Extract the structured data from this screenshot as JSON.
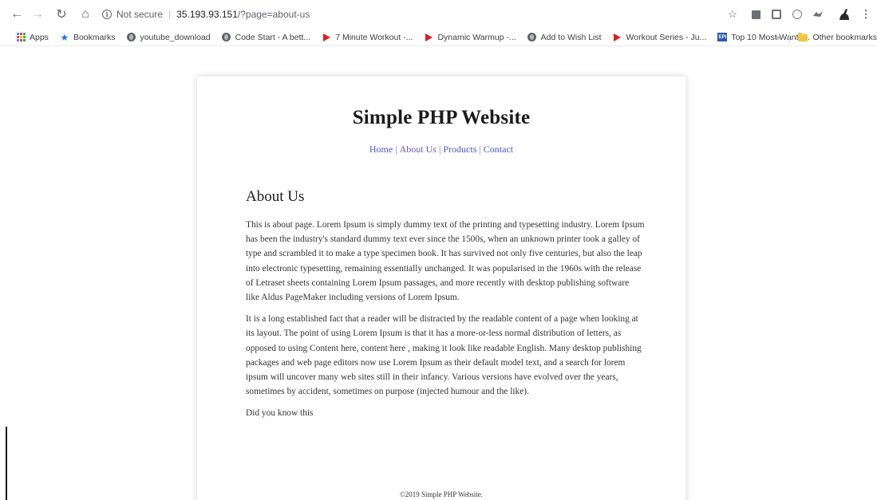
{
  "browser": {
    "url_security": "Not secure",
    "url_host": "35.193.93.151",
    "url_path": "/?page=about-us",
    "bookmarks": [
      {
        "label": "Apps",
        "icon": "apps-grid-icon"
      },
      {
        "label": "Bookmarks",
        "icon": "star-icon"
      },
      {
        "label": "youtube_download",
        "icon": "globe-icon"
      },
      {
        "label": "Code Start - A bett...",
        "icon": "globe-icon"
      },
      {
        "label": "7 Minute Workout -...",
        "icon": "youtube-icon"
      },
      {
        "label": "Dynamic Warmup -...",
        "icon": "youtube-icon"
      },
      {
        "label": "Add to Wish List",
        "icon": "globe-icon"
      },
      {
        "label": "Workout Series - Ju...",
        "icon": "youtube-icon"
      },
      {
        "label": "Top 10 Most Wante...",
        "icon": "epi-icon"
      }
    ],
    "other_bookmarks": "Other bookmarks",
    "overflow_chevron": "»"
  },
  "site": {
    "title": "Simple PHP Website",
    "nav": [
      {
        "label": "Home"
      },
      {
        "label": "About Us"
      },
      {
        "label": "Products"
      },
      {
        "label": "Contact"
      }
    ],
    "nav_separator": "|",
    "page_heading": "About Us",
    "paragraphs": [
      "This is about page. Lorem Ipsum is simply dummy text of the printing and typesetting industry. Lorem Ipsum has been the industry's standard dummy text ever since the 1500s, when an unknown printer took a galley of type and scrambled it to make a type specimen book. It has survived not only five centuries, but also the leap into electronic typesetting, remaining essentially unchanged. It was popularised in the 1960s with the release of Letraset sheets containing Lorem Ipsum passages, and more recently with desktop publishing software like Aldus PageMaker including versions of Lorem Ipsum.",
      "It is a long established fact that a reader will be distracted by the readable content of a page when looking at its layout. The point of using Lorem Ipsum is that it has a more-or-less normal distribution of letters, as opposed to using Content here, content here , making it look like readable English. Many desktop publishing packages and web page editors now use Lorem Ipsum as their default model text, and a search for lorem ipsum will uncover many web sites still in their infancy. Various versions have evolved over the years, sometimes by accident, sometimes on purpose (injected humour and the like).",
      "Did you know this"
    ],
    "footer": "©2019 Simple PHP Website."
  }
}
